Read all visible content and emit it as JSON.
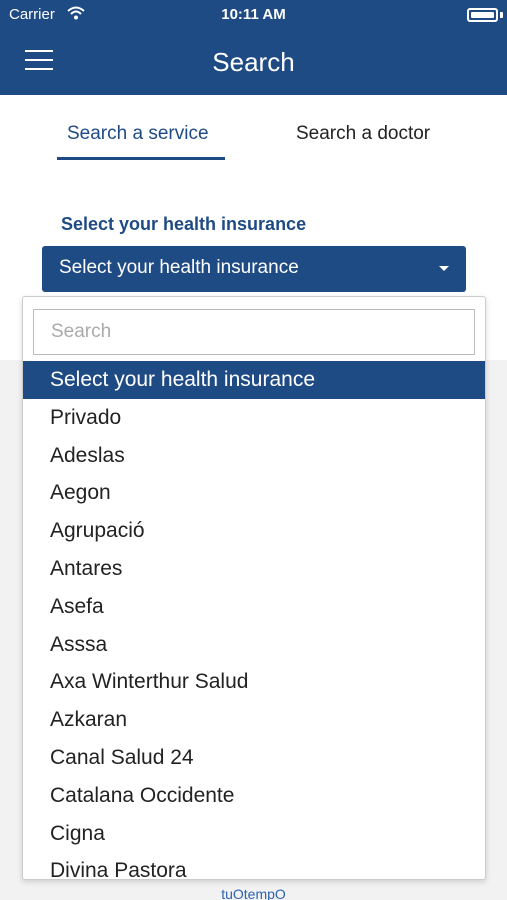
{
  "status_bar": {
    "carrier": "Carrier",
    "time": "10:11 AM"
  },
  "header": {
    "title": "Search"
  },
  "tabs": [
    {
      "label": "Search a service",
      "active": true
    },
    {
      "label": "Search a doctor",
      "active": false
    }
  ],
  "form": {
    "label": "Select your health insurance",
    "select_value": "Select your health insurance"
  },
  "dropdown": {
    "search_placeholder": "Search",
    "options": [
      "Select your health insurance",
      "Privado",
      "Adeslas",
      "Aegon",
      "Agrupació",
      "Antares",
      "Asefa",
      "Asssa",
      "Axa Winterthur Salud",
      "Azkaran",
      "Canal Salud 24",
      "Catalana Occidente",
      "Cigna",
      "Divina Pastora"
    ],
    "selected_index": 0
  },
  "footer": {
    "text": "tuOtempO"
  },
  "colors": {
    "brand": "#1f4b85",
    "footer_text": "#2f62b2"
  }
}
